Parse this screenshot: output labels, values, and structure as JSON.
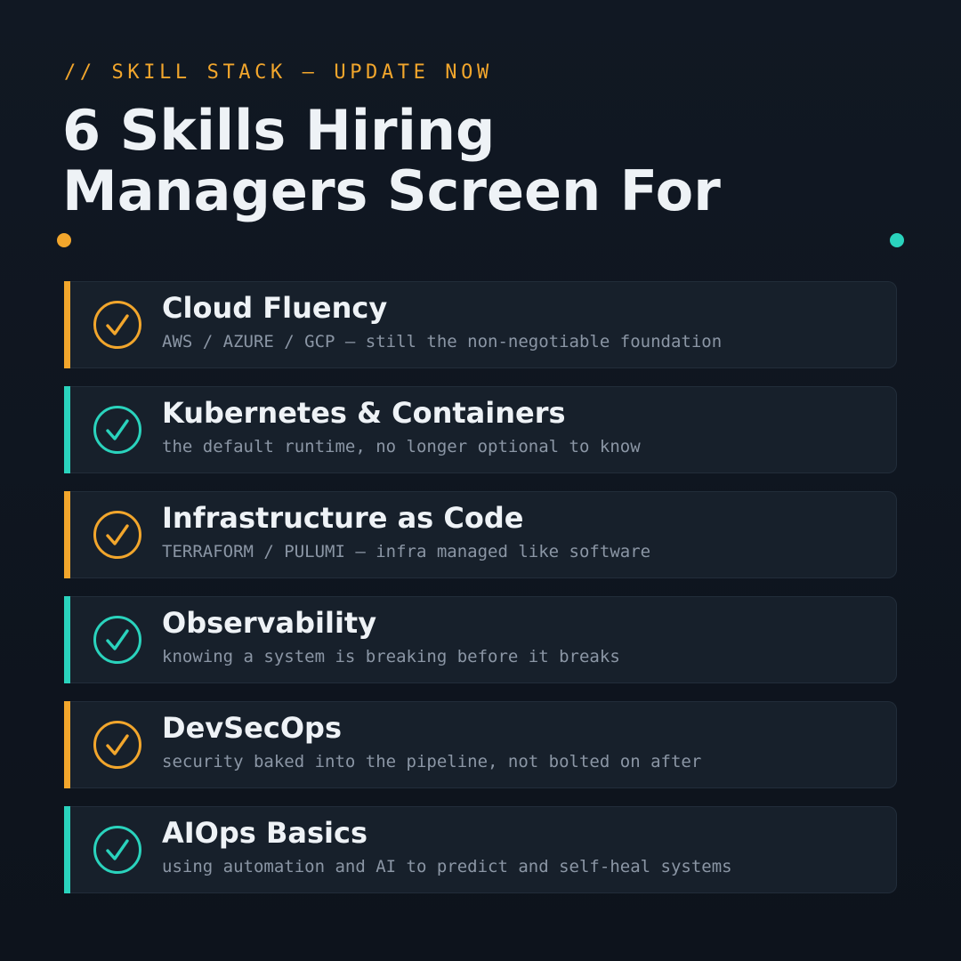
{
  "header": {
    "kicker": "// SKILL STACK — UPDATE NOW",
    "title_line1": "6 Skills Hiring",
    "title_line2": "Managers Screen For"
  },
  "colors": {
    "background": "#111823",
    "amber": "#f2a62c",
    "teal": "#2ad3bd",
    "card": "#17202b"
  },
  "skills": [
    {
      "title": "Cloud Fluency",
      "subtitle": "AWS / AZURE / GCP — still the non-negotiable foundation",
      "accent": "amber",
      "icon": "check-circle-icon"
    },
    {
      "title": "Kubernetes & Containers",
      "subtitle": "the default runtime, no longer optional to know",
      "accent": "teal",
      "icon": "check-circle-icon"
    },
    {
      "title": "Infrastructure as Code",
      "subtitle": "TERRAFORM / PULUMI — infra managed like software",
      "accent": "amber",
      "icon": "check-circle-icon"
    },
    {
      "title": "Observability",
      "subtitle": "knowing a system is breaking before it breaks",
      "accent": "teal",
      "icon": "check-circle-icon"
    },
    {
      "title": "DevSecOps",
      "subtitle": "security baked into the pipeline, not bolted on after",
      "accent": "amber",
      "icon": "check-circle-icon"
    },
    {
      "title": "AIOps Basics",
      "subtitle": "using automation and AI to predict and self-heal systems",
      "accent": "teal",
      "icon": "check-circle-icon"
    }
  ]
}
